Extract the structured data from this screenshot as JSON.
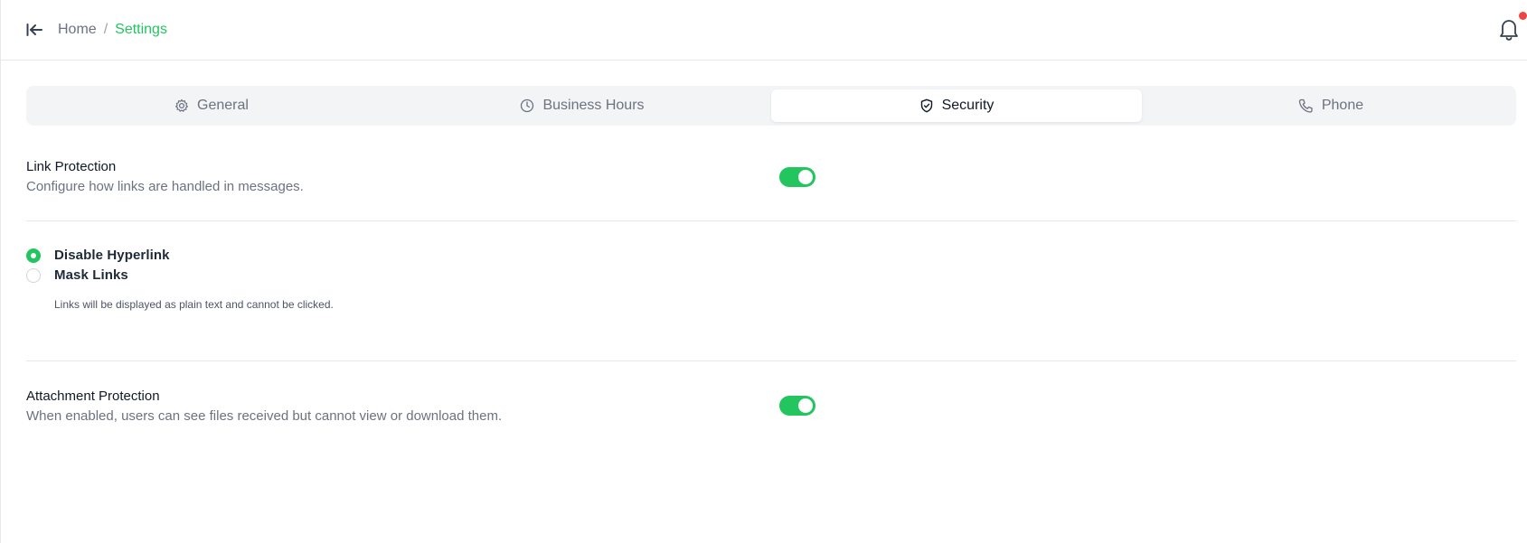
{
  "header": {
    "collapse_icon": "collapse-left-icon",
    "breadcrumb": {
      "home": "Home",
      "separator": "/",
      "current": "Settings"
    },
    "notification_icon": "bell-icon",
    "notification_badge_color": "#ef4444"
  },
  "tabs": [
    {
      "label": "General",
      "icon": "gear-icon",
      "active": false
    },
    {
      "label": "Business Hours",
      "icon": "clock-icon",
      "active": false
    },
    {
      "label": "Security",
      "icon": "shield-check-icon",
      "active": true
    },
    {
      "label": "Phone",
      "icon": "phone-icon",
      "active": false
    }
  ],
  "link_protection": {
    "title": "Link Protection",
    "description": "Configure how links are handled in messages.",
    "enabled": true,
    "options": [
      {
        "label": "Disable Hyperlink",
        "selected": true
      },
      {
        "label": "Mask Links",
        "selected": false
      }
    ],
    "help_text": "Links will be displayed as plain text and cannot be clicked."
  },
  "attachment_protection": {
    "title": "Attachment Protection",
    "description": "When enabled, users can see files received but cannot view or download them.",
    "enabled": true
  },
  "colors": {
    "accent": "#22c55e",
    "text_primary": "#111827",
    "text_muted": "#6b7280",
    "tab_background": "#f3f4f6"
  }
}
